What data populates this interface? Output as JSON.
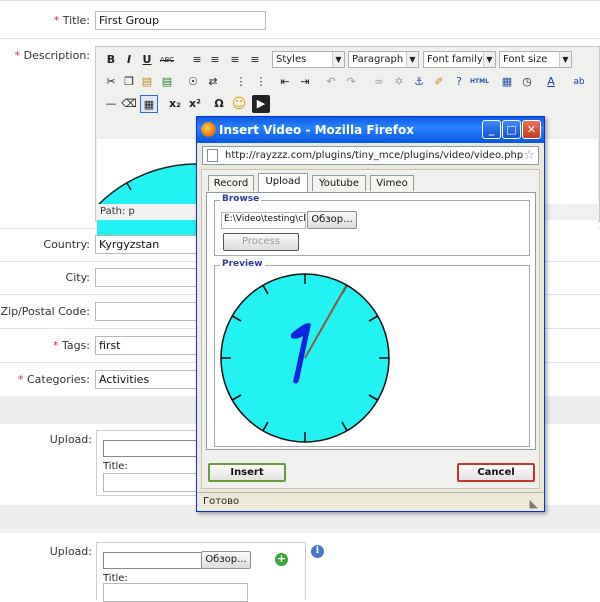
{
  "form": {
    "title_label": "Title:",
    "title_value": "First Group",
    "description_label": "Description:",
    "country_label": "Country:",
    "country_value": "Kyrgyzstan",
    "city_label": "City:",
    "zip_label": "Zip/Postal Code:",
    "tags_label": "Tags:",
    "tags_value": "first",
    "categories_label": "Categories:",
    "categories_value": "Activities",
    "required_mark": "*"
  },
  "editor": {
    "bold": "B",
    "italic": "I",
    "underline": "U",
    "strike": "ABC",
    "styles": "Styles",
    "paragraph": "Paragraph",
    "font_family": "Font family",
    "font_size": "Font size",
    "html_label": "HTML",
    "subscript": "x₂",
    "superscript": "x²",
    "omega": "Ω",
    "emoticon": "☺",
    "path": "Path: p"
  },
  "uploads": [
    {
      "label": "Upload:",
      "title_label": "Title:"
    },
    {
      "label": "Upload:",
      "title_label": "Title:",
      "browse": "Обзор..."
    }
  ],
  "popup": {
    "window_title": "Insert Video - Mozilla Firefox",
    "url": "http://rayzzz.com/plugins/tiny_mce/plugins/video/video.php",
    "tabs": [
      "Record",
      "Upload",
      "Youtube",
      "Vimeo"
    ],
    "active_tab": "Upload",
    "browse_legend": "Browse",
    "file_value": "E:\\Video\\testing\\clock",
    "browse_button": "Обзор...",
    "process_button": "Process",
    "preview_legend": "Preview",
    "insert_button": "Insert",
    "cancel_button": "Cancel",
    "status": "Готово"
  },
  "colors": {
    "accent_blue": "#0a5ee0",
    "clock_face": "#22f2f2",
    "clock_hand": "#1024e0",
    "required": "#e02a20"
  }
}
